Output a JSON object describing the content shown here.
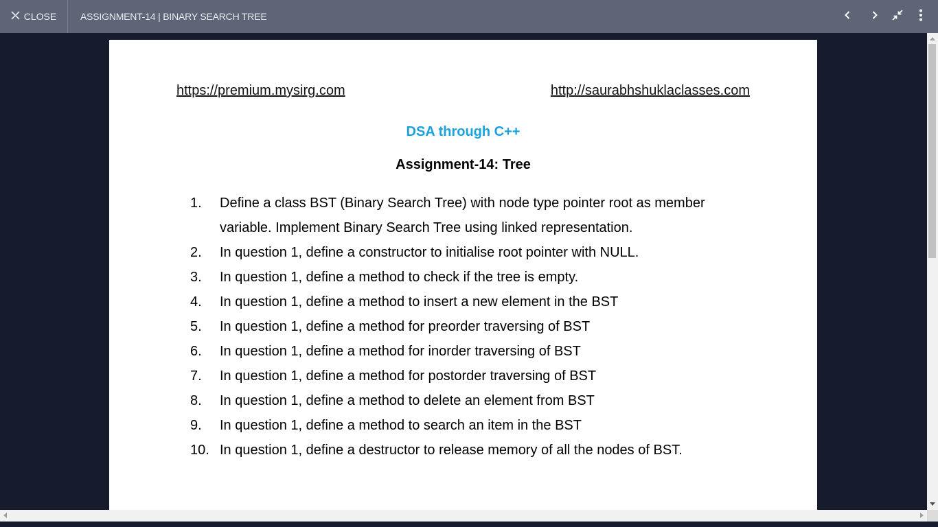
{
  "toolbar": {
    "close_label": "CLOSE",
    "document_title": "ASSIGNMENT-14 | BINARY SEARCH TREE",
    "icons": [
      "close-icon",
      "chevron-left-icon",
      "chevron-right-icon",
      "exit-fullscreen-icon",
      "more-vertical-icon"
    ],
    "background_color": "#5f6577"
  },
  "document": {
    "link_left": "https://premium.mysirg.com",
    "link_right": "http://saurabhshuklaclasses.com",
    "subject": "DSA through C++",
    "subject_color": "#1aa2df",
    "heading": "Assignment-14: Tree",
    "questions": [
      {
        "num": "1.",
        "text": "Define a class BST (Binary Search Tree) with node type pointer root as member variable. Implement Binary Search Tree using linked representation."
      },
      {
        "num": "2.",
        "text": "In question 1, define a constructor to initialise root pointer with NULL."
      },
      {
        "num": "3.",
        "text": "In question 1, define a method to check if the tree is empty."
      },
      {
        "num": "4.",
        "text": "In question 1, define a method to insert a new element in the BST"
      },
      {
        "num": "5.",
        "text": "In question 1, define a method for preorder traversing of BST"
      },
      {
        "num": "6.",
        "text": "In question 1, define a method for inorder traversing of BST"
      },
      {
        "num": "7.",
        "text": "In question 1, define a method for postorder traversing of BST"
      },
      {
        "num": "8.",
        "text": "In question 1, define a method to delete an element from BST"
      },
      {
        "num": "9.",
        "text": "In question 1, define a method to search an item in the BST"
      },
      {
        "num": "10.",
        "text": "In question 1, define a destructor to release memory of all the nodes of BST."
      }
    ]
  },
  "viewer_background_color": "#161c2e"
}
